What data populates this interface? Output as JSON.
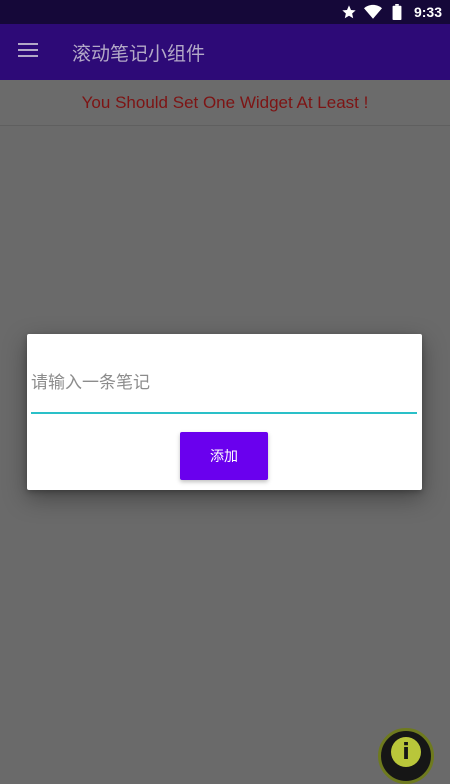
{
  "status_bar": {
    "time": "9:33",
    "icons": [
      "star-icon",
      "wifi-icon",
      "battery-icon"
    ]
  },
  "app_bar": {
    "menu_icon": "hamburger-menu-icon",
    "title": "滚动笔记小组件"
  },
  "banner": {
    "text": "You Should Set One Widget At Least !"
  },
  "dialog": {
    "input_placeholder": "请输入一条笔记",
    "input_value": "",
    "add_button_label": "添加"
  },
  "floating_widget": {
    "icon": "info-icon"
  },
  "colors": {
    "status_bar_bg": "#150839",
    "app_bar_bg": "#2d0a77",
    "scrim": "#6a6a6a",
    "banner_text": "#7d1414",
    "input_underline": "#2ac0c8",
    "accent_button": "#6a00ee"
  }
}
